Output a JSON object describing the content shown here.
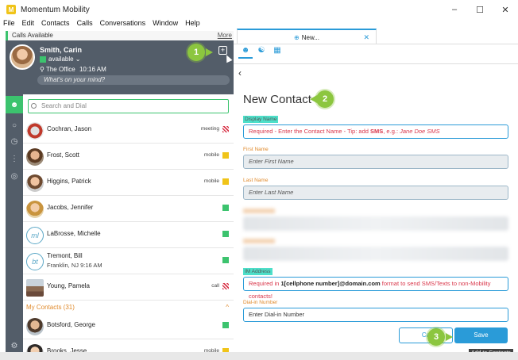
{
  "window": {
    "title": "Momentum Mobility",
    "logo_letter": "M"
  },
  "window_controls": {
    "minimize": "–",
    "maximize": "☐",
    "close": "✕"
  },
  "menu": [
    "File",
    "Edit",
    "Contacts",
    "Calls",
    "Conversations",
    "Window",
    "Help"
  ],
  "calls_bar": {
    "label": "Calls Available",
    "more": "More"
  },
  "profile": {
    "name": "Smith, Carin",
    "status": "available",
    "location": "The Office",
    "time": "10:16 AM",
    "mind_placeholder": "What's on your mind?"
  },
  "search": {
    "placeholder": "Search and Dial"
  },
  "contacts": [
    {
      "name": "Cochran, Jason",
      "meta": "meeting",
      "status": "red"
    },
    {
      "name": "Frost, Scott",
      "meta": "mobile",
      "status": "yellow"
    },
    {
      "name": "Higgins, Patrick",
      "meta": "mobile",
      "status": "yellow"
    },
    {
      "name": "Jacobs, Jennifer",
      "meta": "",
      "status": "green"
    },
    {
      "name": "LaBrosse, Michelle",
      "initials": "ml",
      "meta": "",
      "status": "green"
    },
    {
      "name": "Tremont, Bill",
      "initials": "bt",
      "sub": "Franklin, NJ 9:16 AM",
      "meta": "",
      "status": "green"
    },
    {
      "name": "Young, Pamela",
      "meta": "call",
      "status": "red"
    }
  ],
  "my_contacts": {
    "header": "My Contacts (31)",
    "items": [
      {
        "name": "Botsford, George",
        "meta": "",
        "status": "green"
      },
      {
        "name": "Brooks, Jesse",
        "meta": "mobile",
        "status": "yellow"
      }
    ]
  },
  "tab": {
    "label": "New..."
  },
  "form": {
    "heading": "New Contact",
    "display_name": {
      "label": "Display Name",
      "prefix": "Required - Enter the Contact Name - Tip: add ",
      "bold": "SMS",
      "suffix": ", e.g.: ",
      "example": "Jane Doe SMS"
    },
    "first_name": {
      "label": "First Name",
      "placeholder": "Enter First Name"
    },
    "last_name": {
      "label": "Last Name",
      "placeholder": "Enter Last Name"
    },
    "im_address": {
      "label": "IM Address",
      "prefix": "Required in ",
      "bold": "1[cellphone number]@domain.com",
      "suffix": " format to send SMS/Texts to non-Mobility contacts!"
    },
    "dial_in": {
      "label": "Dial-in Number",
      "placeholder": "Enter Dial-in Number"
    },
    "cancel": "Ca",
    "save": "Save",
    "tooltip": "Add to Contacts"
  },
  "callouts": {
    "one": "1",
    "two": "2",
    "three": "3"
  },
  "colors": {
    "accent_green": "#3cc36e",
    "accent_blue": "#2a9bd8",
    "callout_green": "#8cc63f",
    "sidebar_slate": "#535d69"
  }
}
